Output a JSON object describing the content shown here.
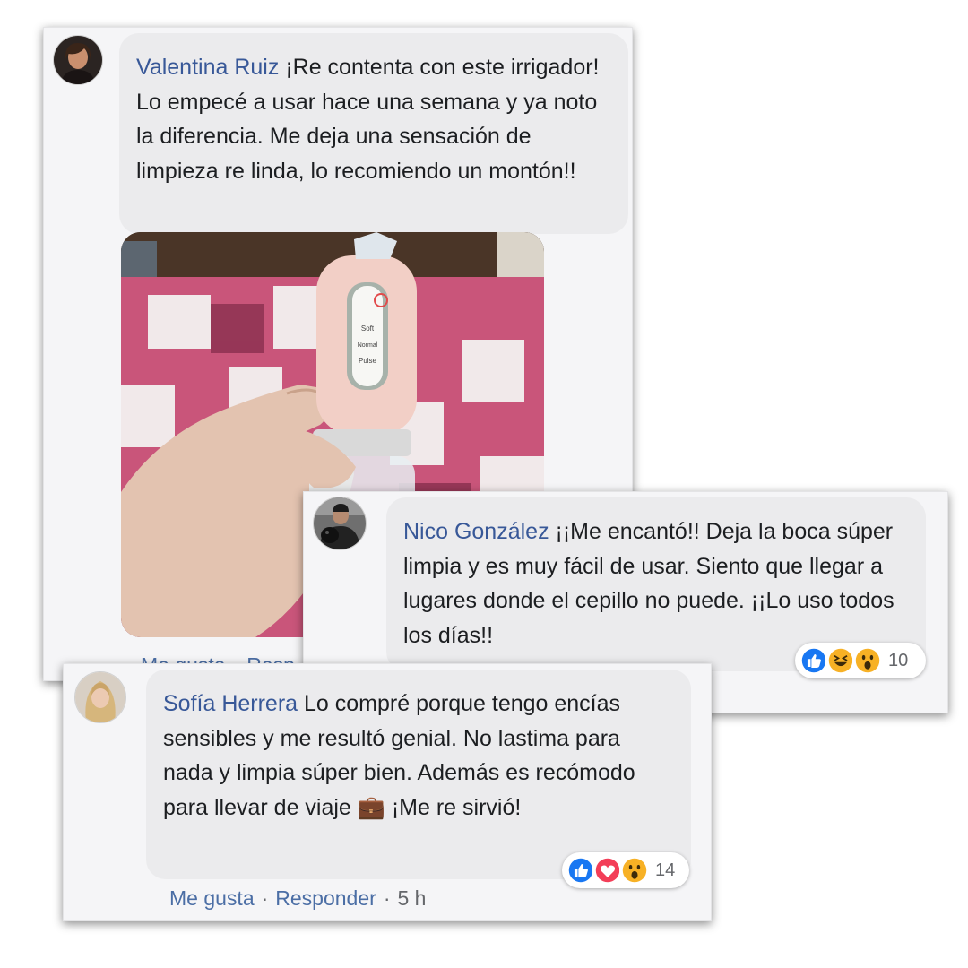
{
  "comments": [
    {
      "author": "Valentina Ruiz",
      "text": "¡Re contenta con este irrigador! Lo empecé a usar hace una semana y ya noto la diferencia. Me deja una sensación de limpieza re linda, lo recomiendo un montón!!",
      "photo_icon": "product-photo",
      "actions": {
        "like": "Me gusta",
        "reply": "Resp"
      }
    },
    {
      "author": "Nico González",
      "text": "¡¡Me encantó!! Deja la boca súper limpia y es muy fácil de usar. Siento que llegar a lugares donde el cepillo no puede. ¡¡Lo uso todos los días!!",
      "reactions": {
        "icons": [
          "like-icon",
          "laugh-icon",
          "wow-icon"
        ],
        "count": "10"
      }
    },
    {
      "author": "Sofía Herrera",
      "text": "Lo compré porque tengo encías sensibles y me resultó genial. No lastima para nada y limpia súper bien. Además es recómodo para llevar de viaje 💼 ¡Me re sirvió!",
      "reactions": {
        "icons": [
          "like-icon",
          "love-icon",
          "wow-icon"
        ],
        "count": "14"
      },
      "actions": {
        "like": "Me gusta",
        "dot": "·",
        "reply": "Responder",
        "time": "5 h"
      }
    }
  ],
  "photo_labels": {
    "mode1": "Soft",
    "mode2": "Normal",
    "mode3": "Pulse"
  },
  "colors": {
    "author": "#385898",
    "bubble": "#ebebed",
    "like": "#1877f2",
    "love": "#f33e58",
    "haha": "#f7b125"
  }
}
